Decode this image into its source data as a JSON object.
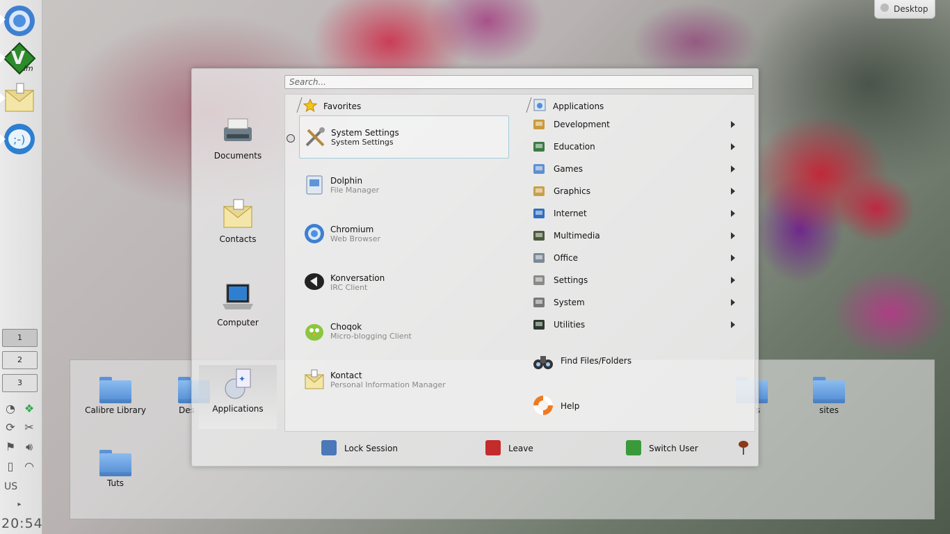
{
  "panel": {
    "launchers": [
      {
        "name": "chromium-icon"
      },
      {
        "name": "gvim-icon"
      },
      {
        "name": "kontact-icon"
      },
      {
        "name": "konversation-icon"
      }
    ],
    "pager": [
      "1",
      "2",
      "3"
    ],
    "keyboard_layout": "US",
    "clock": "20:54"
  },
  "desktop_button": {
    "label": "Desktop"
  },
  "folder_view": {
    "folders": [
      "Calibre Library",
      "Des",
      "s",
      "sites",
      "Tuts"
    ]
  },
  "kickoff": {
    "search_placeholder": "Search...",
    "tabs": [
      {
        "label": "Documents",
        "icon": "typewriter-icon"
      },
      {
        "label": "Contacts",
        "icon": "contacts-icon"
      },
      {
        "label": "Computer",
        "icon": "laptop-icon"
      },
      {
        "label": "Applications",
        "icon": "applications-icon"
      }
    ],
    "favorites_header": "Favorites",
    "favorites": [
      {
        "name": "System Settings",
        "desc": "System Settings",
        "icon": "tools-icon"
      },
      {
        "name": "Dolphin",
        "desc": "File Manager",
        "icon": "dolphin-icon"
      },
      {
        "name": "Chromium",
        "desc": "Web Browser",
        "icon": "chromium-icon"
      },
      {
        "name": "Konversation",
        "desc": "IRC Client",
        "icon": "konversation-icon"
      },
      {
        "name": "Choqok",
        "desc": "Micro-blogging Client",
        "icon": "choqok-icon"
      },
      {
        "name": "Kontact",
        "desc": "Personal Information Manager",
        "icon": "kontact-icon"
      }
    ],
    "applications_header": "Applications",
    "categories": [
      {
        "label": "Development",
        "icon": "development-icon"
      },
      {
        "label": "Education",
        "icon": "education-icon"
      },
      {
        "label": "Games",
        "icon": "games-icon"
      },
      {
        "label": "Graphics",
        "icon": "graphics-icon"
      },
      {
        "label": "Internet",
        "icon": "internet-icon"
      },
      {
        "label": "Multimedia",
        "icon": "multimedia-icon"
      },
      {
        "label": "Office",
        "icon": "office-icon"
      },
      {
        "label": "Settings",
        "icon": "settings-icon"
      },
      {
        "label": "System",
        "icon": "system-icon"
      },
      {
        "label": "Utilities",
        "icon": "utilities-icon"
      }
    ],
    "find_files": "Find Files/Folders",
    "help": "Help",
    "bottom": {
      "lock": "Lock Session",
      "leave": "Leave",
      "switch_user": "Switch User"
    }
  }
}
